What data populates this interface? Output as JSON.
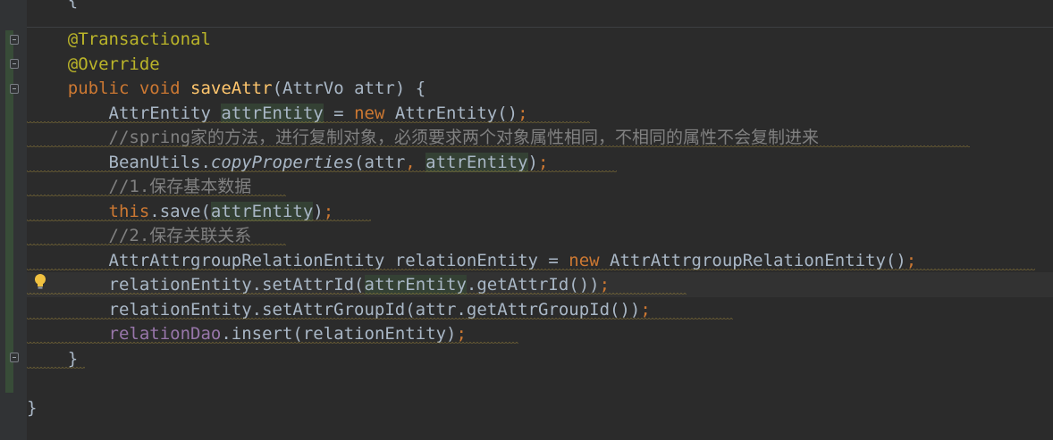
{
  "code_lines": [
    {
      "tokens": [
        {
          "text": "    ",
          "c": ""
        },
        {
          "text": "@Transactional",
          "c": "ann"
        }
      ]
    },
    {
      "tokens": [
        {
          "text": "    ",
          "c": ""
        },
        {
          "text": "@Override",
          "c": "ann"
        }
      ]
    },
    {
      "tokens": [
        {
          "text": "    ",
          "c": ""
        },
        {
          "text": "public ",
          "c": "kw"
        },
        {
          "text": "void ",
          "c": "kw"
        },
        {
          "text": "saveAttr",
          "c": "fn"
        },
        {
          "text": "(AttrVo attr) {",
          "c": ""
        }
      ]
    },
    {
      "tokens": [
        {
          "text": "        AttrEntity ",
          "c": ""
        },
        {
          "text": "attrEntity",
          "c": "usage"
        },
        {
          "text": " = ",
          "c": ""
        },
        {
          "text": "new ",
          "c": "kw"
        },
        {
          "text": "AttrEntity()",
          "c": ""
        },
        {
          "text": ";",
          "c": "kw"
        }
      ]
    },
    {
      "tokens": [
        {
          "text": "        ",
          "c": ""
        },
        {
          "text": "//spring家的方法，进行复制对象，必须要求两个对象属性相同，不相同的属性不会复制进来",
          "c": "cm"
        }
      ]
    },
    {
      "tokens": [
        {
          "text": "        BeanUtils.",
          "c": ""
        },
        {
          "text": "copyProperties",
          "c": "ital"
        },
        {
          "text": "(attr",
          "c": ""
        },
        {
          "text": ", ",
          "c": "kw"
        },
        {
          "text": "attrEntity",
          "c": "usage"
        },
        {
          "text": ")",
          "c": ""
        },
        {
          "text": ";",
          "c": "kw"
        }
      ]
    },
    {
      "tokens": [
        {
          "text": "        ",
          "c": ""
        },
        {
          "text": "//1.保存基本数据",
          "c": "cm"
        }
      ]
    },
    {
      "tokens": [
        {
          "text": "        ",
          "c": ""
        },
        {
          "text": "this",
          "c": "kw"
        },
        {
          "text": ".save(",
          "c": ""
        },
        {
          "text": "attrEntity",
          "c": "usage"
        },
        {
          "text": ")",
          "c": ""
        },
        {
          "text": ";",
          "c": "kw"
        }
      ]
    },
    {
      "tokens": [
        {
          "text": "        ",
          "c": ""
        },
        {
          "text": "//2.保存关联关系",
          "c": "cm"
        }
      ]
    },
    {
      "tokens": [
        {
          "text": "        AttrAttrgroupRelationEntity relationEntity = ",
          "c": ""
        },
        {
          "text": "new ",
          "c": "kw"
        },
        {
          "text": "AttrAttrgroupRelationEntity()",
          "c": ""
        },
        {
          "text": ";",
          "c": "kw"
        }
      ]
    },
    {
      "tokens": [
        {
          "text": "        relationEntity.setAttrId(",
          "c": ""
        },
        {
          "text": "attrEntity",
          "c": "usage"
        },
        {
          "text": ".getAttrId())",
          "c": ""
        },
        {
          "text": ";",
          "c": "kw"
        }
      ]
    },
    {
      "tokens": [
        {
          "text": "        relationEntity.setAttrGroupId(attr.getAttrGroupId())",
          "c": ""
        },
        {
          "text": ";",
          "c": "kw"
        }
      ]
    },
    {
      "tokens": [
        {
          "text": "        ",
          "c": ""
        },
        {
          "text": "relationDao",
          "c": "field"
        },
        {
          "text": ".insert(relationEntity)",
          "c": ""
        },
        {
          "text": ";",
          "c": "kw"
        }
      ]
    },
    {
      "tokens": [
        {
          "text": "    }",
          "c": ""
        }
      ]
    },
    {
      "tokens": [
        {
          "text": "",
          "c": ""
        }
      ]
    },
    {
      "tokens": [
        {
          "text": "}",
          "c": ""
        }
      ]
    }
  ],
  "top_partial": "{",
  "icons": {
    "intention_bulb": "lightbulb-icon",
    "fold_marker": "fold-icon"
  },
  "colors": {
    "background": "#2b2b2b",
    "keyword": "#cc7832",
    "annotation": "#bbb529",
    "method_decl": "#ffc66d",
    "comment": "#808080",
    "field": "#9876aa",
    "default_text": "#a9b7c6",
    "warning_underline": "#b89a3e"
  }
}
